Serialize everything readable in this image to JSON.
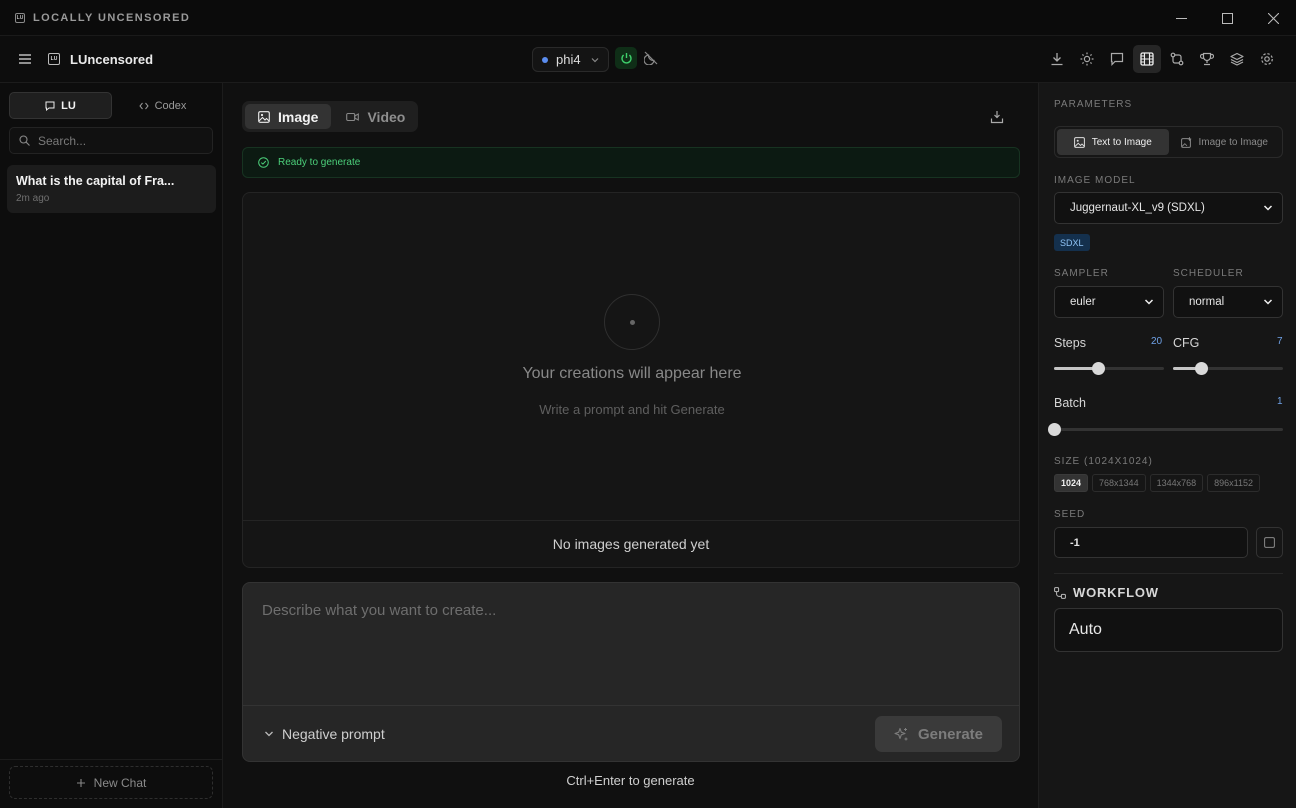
{
  "titlebar": {
    "title": "LOCALLY UNCENSORED",
    "logo_text": "LU"
  },
  "header": {
    "app_name": "LUncensored",
    "logo_text": "LU",
    "model": {
      "name": "phi4",
      "dot_color": "#5b8def"
    },
    "icons": [
      "download-icon",
      "sun-icon",
      "chat-icon",
      "film-icon",
      "compare-icon",
      "trophy-icon",
      "layers-icon",
      "gear-icon"
    ],
    "active_icon": "film-icon"
  },
  "sidebar": {
    "tabs": [
      {
        "label": "LU",
        "active": true
      },
      {
        "label": "Codex",
        "active": false
      }
    ],
    "search_placeholder": "Search...",
    "chats": [
      {
        "title": "What is the capital of Fra...",
        "time": "2m ago"
      }
    ],
    "new_chat_label": "New Chat"
  },
  "main": {
    "tabs": [
      {
        "label": "Image",
        "active": true
      },
      {
        "label": "Video",
        "active": false
      }
    ],
    "status": "Ready to generate",
    "empty_title": "Your creations will appear here",
    "empty_sub": "Write a prompt and hit Generate",
    "gallery_footer": "No images generated yet",
    "prompt_placeholder": "Describe what you want to create...",
    "negative_prompt_label": "Negative prompt",
    "generate_label": "Generate",
    "hint": "Ctrl+Enter to generate"
  },
  "panel": {
    "parameters_label": "PARAMETERS",
    "modes": [
      {
        "label": "Text to Image",
        "active": true
      },
      {
        "label": "Image to Image",
        "active": false
      }
    ],
    "image_model_label": "IMAGE MODEL",
    "image_model": "Juggernaut-XL_v9 (SDXL)",
    "model_badge": "SDXL",
    "sampler_label": "SAMPLER",
    "sampler": "euler",
    "scheduler_label": "SCHEDULER",
    "scheduler": "normal",
    "steps": {
      "label": "Steps",
      "value": "20",
      "fraction": 0.4
    },
    "cfg": {
      "label": "CFG",
      "value": "7",
      "fraction": 0.25
    },
    "batch": {
      "label": "Batch",
      "value": "1",
      "fraction": 0
    },
    "size_label": "SIZE (1024X1024)",
    "sizes": [
      {
        "label": "1024",
        "active": true
      },
      {
        "label": "768x1344",
        "active": false
      },
      {
        "label": "1344x768",
        "active": false
      },
      {
        "label": "896x1152",
        "active": false
      }
    ],
    "seed_label": "SEED",
    "seed": "-1",
    "workflow_label": "WORKFLOW",
    "workflow": "Auto"
  }
}
